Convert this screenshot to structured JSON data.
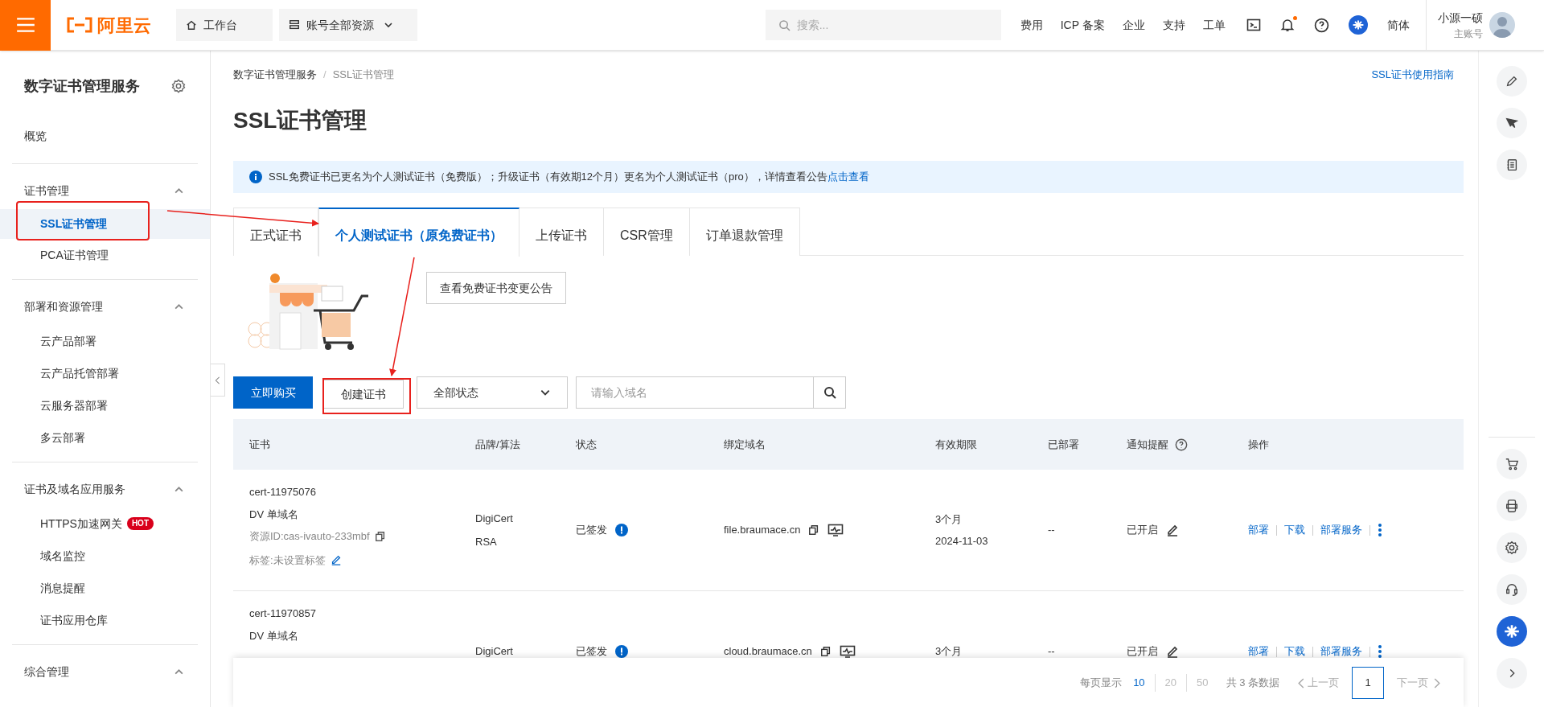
{
  "topbar": {
    "logo": "阿里云",
    "workbench": "工作台",
    "resources": "账号全部资源",
    "search_placeholder": "搜索...",
    "links": [
      "费用",
      "ICP 备案",
      "企业",
      "支持",
      "工单"
    ],
    "notification_dot": true,
    "language": "简体",
    "user_name": "小源一硕",
    "account_type": "主账号"
  },
  "sidebar": {
    "title": "数字证书管理服务",
    "overview": {
      "label": "概览",
      "selected": false
    },
    "groups": [
      {
        "label": "证书管理",
        "expanded": true,
        "children": [
          {
            "label": "SSL证书管理",
            "selected": true
          },
          {
            "label": "PCA证书管理",
            "selected": false
          }
        ]
      },
      {
        "label": "部署和资源管理",
        "expanded": true,
        "children": [
          {
            "label": "云产品部署",
            "selected": false
          },
          {
            "label": "云产品托管部署",
            "selected": false
          },
          {
            "label": "云服务器部署",
            "selected": false
          },
          {
            "label": "多云部署",
            "selected": false
          }
        ]
      },
      {
        "label": "证书及域名应用服务",
        "expanded": true,
        "children": [
          {
            "label": "HTTPS加速网关",
            "selected": false,
            "badge": "HOT"
          },
          {
            "label": "域名监控",
            "selected": false
          },
          {
            "label": "消息提醒",
            "selected": false
          },
          {
            "label": "证书应用仓库",
            "selected": false
          }
        ]
      },
      {
        "label": "综合管理",
        "expanded": true
      }
    ]
  },
  "breadcrumb": [
    "数字证书管理服务",
    "SSL证书管理"
  ],
  "breadcrumb_separator": "/",
  "guide_link": "SSL证书使用指南",
  "page_title": "SSL证书管理",
  "notice": {
    "text": "SSL免费证书已更名为个人测试证书（免费版）；升级证书（有效期12个月）更名为个人测试证书（pro），详情查看公告",
    "link": "点击查看"
  },
  "tabs": [
    {
      "label": "正式证书",
      "selected": false
    },
    {
      "label": "个人测试证书（原免费证书）",
      "selected": true
    },
    {
      "label": "上传证书",
      "selected": false
    },
    {
      "label": "CSR管理",
      "selected": false
    },
    {
      "label": "订单退款管理",
      "selected": false
    }
  ],
  "announcement_button": "查看免费证书变更公告",
  "toolbar": {
    "buy_button": "立即购买",
    "create_button": "创建证书",
    "status_filter": "全部状态",
    "domain_placeholder": "请输入域名"
  },
  "table": {
    "columns": [
      "证书",
      "品牌/算法",
      "状态",
      "绑定域名",
      "有效期限",
      "已部署",
      "通知提醒",
      "操作"
    ],
    "rows": [
      {
        "cert": [
          "cert-11975076",
          "DV 单域名"
        ],
        "resource_id": "资源ID:cas-ivauto-233mbf",
        "tag": "标签:未设置标签",
        "brand": [
          "DigiCert",
          "RSA"
        ],
        "status": "已签发",
        "domain": "file.braumace.cn",
        "validity": [
          "3个月",
          "2024-11-03"
        ],
        "deployed": "--",
        "notify": "已开启",
        "actions": [
          "部署",
          "下载",
          "部署服务"
        ]
      },
      {
        "cert": [
          "cert-11970857",
          "DV 单域名"
        ],
        "brand": [
          "DigiCert"
        ],
        "status": "已签发",
        "domain": "cloud.braumace.cn",
        "validity": [
          "3个月"
        ],
        "deployed": "--",
        "notify": "已开启",
        "actions": [
          "部署",
          "下载",
          "部署服务"
        ]
      }
    ]
  },
  "pagination": {
    "label": "每页显示",
    "sizes": [
      {
        "label": "10",
        "selected": true
      },
      {
        "label": "20",
        "selected": false
      },
      {
        "label": "50",
        "selected": false
      }
    ],
    "total": "共 3 条数据",
    "prev": "上一页",
    "page": "1",
    "next": "下一页"
  }
}
